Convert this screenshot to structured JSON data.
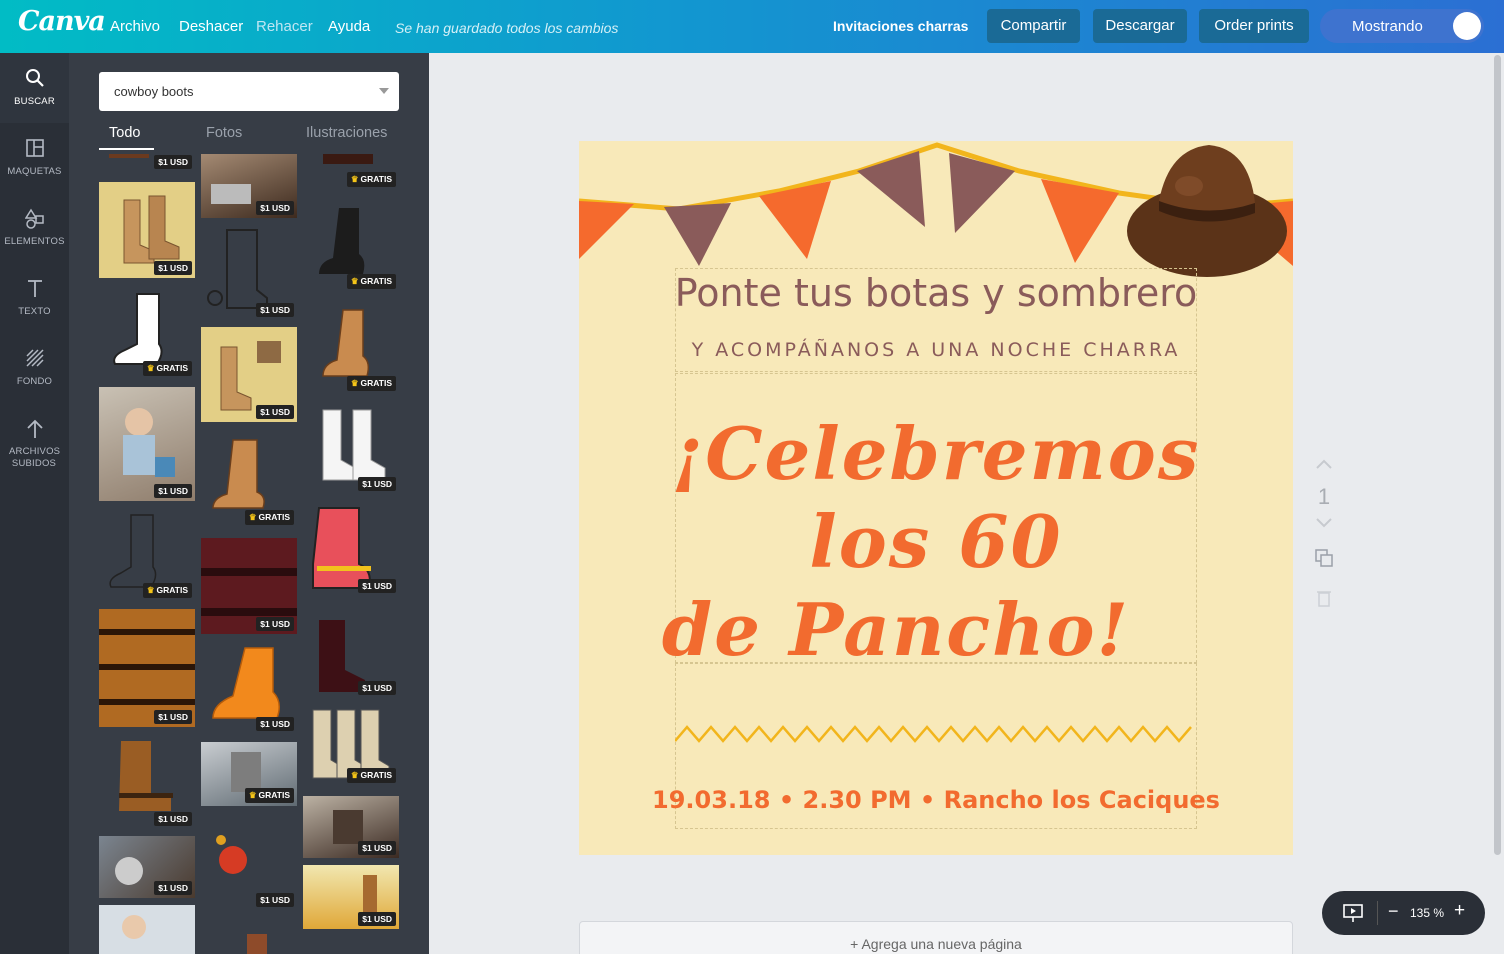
{
  "topbar": {
    "logo": "Canva",
    "menu": [
      "Archivo",
      "Deshacer",
      "Rehacer",
      "Ayuda"
    ],
    "saved_status": "Se han guardado todos los cambios",
    "doc_title": "Invitaciones charras",
    "share": "Compartir",
    "download": "Descargar",
    "order": "Order prints",
    "showing": "Mostrando"
  },
  "rail": [
    {
      "label": "BUSCAR",
      "icon": "search-icon"
    },
    {
      "label": "MAQUETAS",
      "icon": "layout-icon"
    },
    {
      "label": "ELEMENTOS",
      "icon": "shapes-icon"
    },
    {
      "label": "TEXTO",
      "icon": "text-icon"
    },
    {
      "label": "FONDO",
      "icon": "background-icon"
    },
    {
      "label": "ARCHIVOS SUBIDOS",
      "icon": "upload-icon"
    }
  ],
  "search": {
    "value": "cowboy boots"
  },
  "tabs": [
    "Todo",
    "Fotos",
    "Ilustraciones"
  ],
  "badges": {
    "paid": "$1 USD",
    "free": "GRATIS"
  },
  "design": {
    "headline": "Ponte tus botas y sombrero",
    "subline": "Y ACOMPÁÑANOS A UNA NOCHE CHARRA",
    "script1": "¡Celebremos",
    "script2": "los 60",
    "script3": "de Pancho!",
    "event": "19.03.18 • 2.30 PM • Rancho los Caciques"
  },
  "page_number": "1",
  "add_page": "+ Agrega una nueva página",
  "zoom": "135 %",
  "colors": {
    "page_bg": "#f8e9b9",
    "orange": "#f26b2f",
    "mauve": "#8a5b5a",
    "gold": "#f2b51c"
  }
}
